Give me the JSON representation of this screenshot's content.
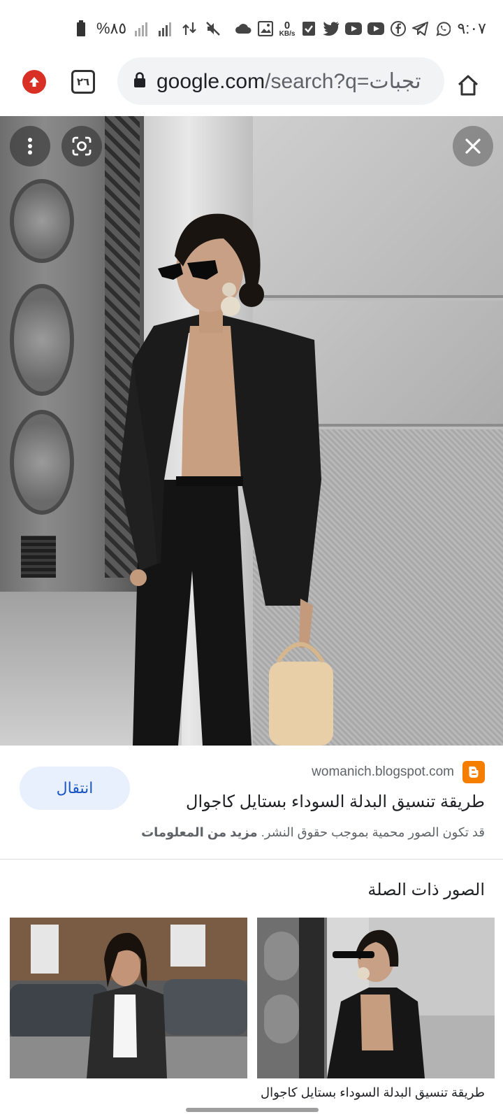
{
  "status_bar": {
    "time": "٩:٠٧",
    "battery": "%٨٥",
    "network_speed_value": "0",
    "network_speed_unit": "KB/s",
    "notification_icons": [
      "whatsapp-icon",
      "telegram-icon",
      "facebook-icon",
      "youtube-icon",
      "youtube-icon",
      "twitter-icon",
      "checklist-icon",
      "kbs-indicator",
      "gallery-icon",
      "cloud-icon"
    ]
  },
  "browser": {
    "url_host": "google.com",
    "url_path": "/search?q=",
    "url_query": "تجبات",
    "tab_count": "٢٦"
  },
  "viewer": {
    "image_alt": "امرأة ترتدي بدلة سوداء"
  },
  "result": {
    "source": "womanich.blogspot.com",
    "title": "طريقة تنسيق البدلة السوداء بستايل كاجوال",
    "visit_label": "انتقال",
    "copyright_notice": "قد تكون الصور محمية بموجب حقوق النشر.",
    "more_info_label": "مزيد من المعلومات"
  },
  "related": {
    "heading": "الصور ذات الصلة",
    "items": [
      {
        "caption": "طريقة تنسيق البدلة السوداء بستايل كاجوال"
      },
      {
        "caption": ""
      }
    ]
  },
  "colors": {
    "accent_blue": "#1a56c4",
    "visit_bg": "#e8f0fe",
    "update_red": "#d93025",
    "blogger_orange": "#f57d00"
  }
}
